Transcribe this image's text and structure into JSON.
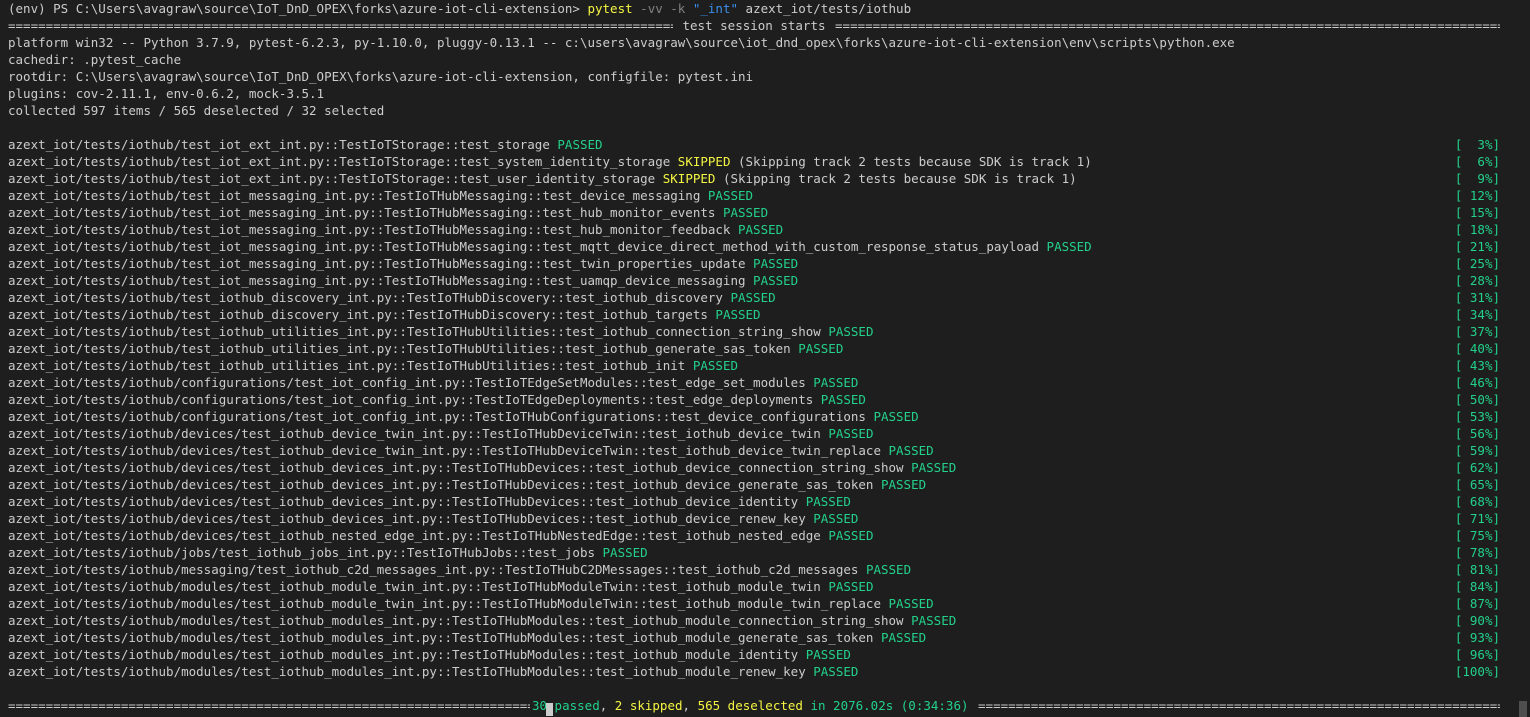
{
  "prompt": {
    "env": "(env) PS C:\\Users\\avagraw\\source\\IoT_DnD_OPEX\\forks\\azure-iot-cli-extension>",
    "command": "pytest",
    "flags": "-vv -k",
    "pattern": "\"_int\"",
    "path": " azext_iot/tests/iothub"
  },
  "session_header": " test session starts ",
  "info_lines": [
    "platform win32 -- Python 3.7.9, pytest-6.2.3, py-1.10.0, pluggy-0.13.1 -- c:\\users\\avagraw\\source\\iot_dnd_opex\\forks\\azure-iot-cli-extension\\env\\scripts\\python.exe",
    "cachedir: .pytest_cache",
    "rootdir: C:\\Users\\avagraw\\source\\IoT_DnD_OPEX\\forks\\azure-iot-cli-extension, configfile: pytest.ini",
    "plugins: cov-2.11.1, env-0.6.2, mock-3.5.1",
    "collected 597 items / 565 deselected / 32 selected"
  ],
  "tests": [
    {
      "name": "azext_iot/tests/iothub/test_iot_ext_int.py::TestIoTStorage::test_storage",
      "status": "PASSED",
      "note": "",
      "pct": "[  3%]"
    },
    {
      "name": "azext_iot/tests/iothub/test_iot_ext_int.py::TestIoTStorage::test_system_identity_storage",
      "status": "SKIPPED",
      "note": " (Skipping track 2 tests because SDK is track 1)",
      "pct": "[  6%]"
    },
    {
      "name": "azext_iot/tests/iothub/test_iot_ext_int.py::TestIoTStorage::test_user_identity_storage",
      "status": "SKIPPED",
      "note": " (Skipping track 2 tests because SDK is track 1)",
      "pct": "[  9%]"
    },
    {
      "name": "azext_iot/tests/iothub/test_iot_messaging_int.py::TestIoTHubMessaging::test_device_messaging",
      "status": "PASSED",
      "note": "",
      "pct": "[ 12%]"
    },
    {
      "name": "azext_iot/tests/iothub/test_iot_messaging_int.py::TestIoTHubMessaging::test_hub_monitor_events",
      "status": "PASSED",
      "note": "",
      "pct": "[ 15%]"
    },
    {
      "name": "azext_iot/tests/iothub/test_iot_messaging_int.py::TestIoTHubMessaging::test_hub_monitor_feedback",
      "status": "PASSED",
      "note": "",
      "pct": "[ 18%]"
    },
    {
      "name": "azext_iot/tests/iothub/test_iot_messaging_int.py::TestIoTHubMessaging::test_mqtt_device_direct_method_with_custom_response_status_payload",
      "status": "PASSED",
      "note": "",
      "pct": "[ 21%]"
    },
    {
      "name": "azext_iot/tests/iothub/test_iot_messaging_int.py::TestIoTHubMessaging::test_twin_properties_update",
      "status": "PASSED",
      "note": "",
      "pct": "[ 25%]"
    },
    {
      "name": "azext_iot/tests/iothub/test_iot_messaging_int.py::TestIoTHubMessaging::test_uamqp_device_messaging",
      "status": "PASSED",
      "note": "",
      "pct": "[ 28%]"
    },
    {
      "name": "azext_iot/tests/iothub/test_iothub_discovery_int.py::TestIoTHubDiscovery::test_iothub_discovery",
      "status": "PASSED",
      "note": "",
      "pct": "[ 31%]"
    },
    {
      "name": "azext_iot/tests/iothub/test_iothub_discovery_int.py::TestIoTHubDiscovery::test_iothub_targets",
      "status": "PASSED",
      "note": "",
      "pct": "[ 34%]"
    },
    {
      "name": "azext_iot/tests/iothub/test_iothub_utilities_int.py::TestIoTHubUtilities::test_iothub_connection_string_show",
      "status": "PASSED",
      "note": "",
      "pct": "[ 37%]"
    },
    {
      "name": "azext_iot/tests/iothub/test_iothub_utilities_int.py::TestIoTHubUtilities::test_iothub_generate_sas_token",
      "status": "PASSED",
      "note": "",
      "pct": "[ 40%]"
    },
    {
      "name": "azext_iot/tests/iothub/test_iothub_utilities_int.py::TestIoTHubUtilities::test_iothub_init",
      "status": "PASSED",
      "note": "",
      "pct": "[ 43%]"
    },
    {
      "name": "azext_iot/tests/iothub/configurations/test_iot_config_int.py::TestIoTEdgeSetModules::test_edge_set_modules",
      "status": "PASSED",
      "note": "",
      "pct": "[ 46%]"
    },
    {
      "name": "azext_iot/tests/iothub/configurations/test_iot_config_int.py::TestIoTEdgeDeployments::test_edge_deployments",
      "status": "PASSED",
      "note": "",
      "pct": "[ 50%]"
    },
    {
      "name": "azext_iot/tests/iothub/configurations/test_iot_config_int.py::TestIoTHubConfigurations::test_device_configurations",
      "status": "PASSED",
      "note": "",
      "pct": "[ 53%]"
    },
    {
      "name": "azext_iot/tests/iothub/devices/test_iothub_device_twin_int.py::TestIoTHubDeviceTwin::test_iothub_device_twin",
      "status": "PASSED",
      "note": "",
      "pct": "[ 56%]"
    },
    {
      "name": "azext_iot/tests/iothub/devices/test_iothub_device_twin_int.py::TestIoTHubDeviceTwin::test_iothub_device_twin_replace",
      "status": "PASSED",
      "note": "",
      "pct": "[ 59%]"
    },
    {
      "name": "azext_iot/tests/iothub/devices/test_iothub_devices_int.py::TestIoTHubDevices::test_iothub_device_connection_string_show",
      "status": "PASSED",
      "note": "",
      "pct": "[ 62%]"
    },
    {
      "name": "azext_iot/tests/iothub/devices/test_iothub_devices_int.py::TestIoTHubDevices::test_iothub_device_generate_sas_token",
      "status": "PASSED",
      "note": "",
      "pct": "[ 65%]"
    },
    {
      "name": "azext_iot/tests/iothub/devices/test_iothub_devices_int.py::TestIoTHubDevices::test_iothub_device_identity",
      "status": "PASSED",
      "note": "",
      "pct": "[ 68%]"
    },
    {
      "name": "azext_iot/tests/iothub/devices/test_iothub_devices_int.py::TestIoTHubDevices::test_iothub_device_renew_key",
      "status": "PASSED",
      "note": "",
      "pct": "[ 71%]"
    },
    {
      "name": "azext_iot/tests/iothub/devices/test_iothub_nested_edge_int.py::TestIoTHubNestedEdge::test_iothub_nested_edge",
      "status": "PASSED",
      "note": "",
      "pct": "[ 75%]"
    },
    {
      "name": "azext_iot/tests/iothub/jobs/test_iothub_jobs_int.py::TestIoTHubJobs::test_jobs",
      "status": "PASSED",
      "note": "",
      "pct": "[ 78%]"
    },
    {
      "name": "azext_iot/tests/iothub/messaging/test_iothub_c2d_messages_int.py::TestIoTHubC2DMessages::test_iothub_c2d_messages",
      "status": "PASSED",
      "note": "",
      "pct": "[ 81%]"
    },
    {
      "name": "azext_iot/tests/iothub/modules/test_iothub_module_twin_int.py::TestIoTHubModuleTwin::test_iothub_module_twin",
      "status": "PASSED",
      "note": "",
      "pct": "[ 84%]"
    },
    {
      "name": "azext_iot/tests/iothub/modules/test_iothub_module_twin_int.py::TestIoTHubModuleTwin::test_iothub_module_twin_replace",
      "status": "PASSED",
      "note": "",
      "pct": "[ 87%]"
    },
    {
      "name": "azext_iot/tests/iothub/modules/test_iothub_modules_int.py::TestIoTHubModules::test_iothub_module_connection_string_show",
      "status": "PASSED",
      "note": "",
      "pct": "[ 90%]"
    },
    {
      "name": "azext_iot/tests/iothub/modules/test_iothub_modules_int.py::TestIoTHubModules::test_iothub_module_generate_sas_token",
      "status": "PASSED",
      "note": "",
      "pct": "[ 93%]"
    },
    {
      "name": "azext_iot/tests/iothub/modules/test_iothub_modules_int.py::TestIoTHubModules::test_iothub_module_identity",
      "status": "PASSED",
      "note": "",
      "pct": "[ 96%]"
    },
    {
      "name": "azext_iot/tests/iothub/modules/test_iothub_modules_int.py::TestIoTHubModules::test_iothub_module_renew_key",
      "status": "PASSED",
      "note": "",
      "pct": "[100%]"
    }
  ],
  "summary": {
    "passed": "30 passed",
    "sep1": ", ",
    "skipped": "2 skipped",
    "sep2": ", ",
    "deselected": "565 deselected",
    "duration": " in 2076.02s (0:34:36) "
  },
  "colors": {
    "background": "#1e1e1e",
    "text": "#cccccc",
    "passed": "#23d18b",
    "skipped": "#f5f543",
    "string": "#3b8eea"
  }
}
